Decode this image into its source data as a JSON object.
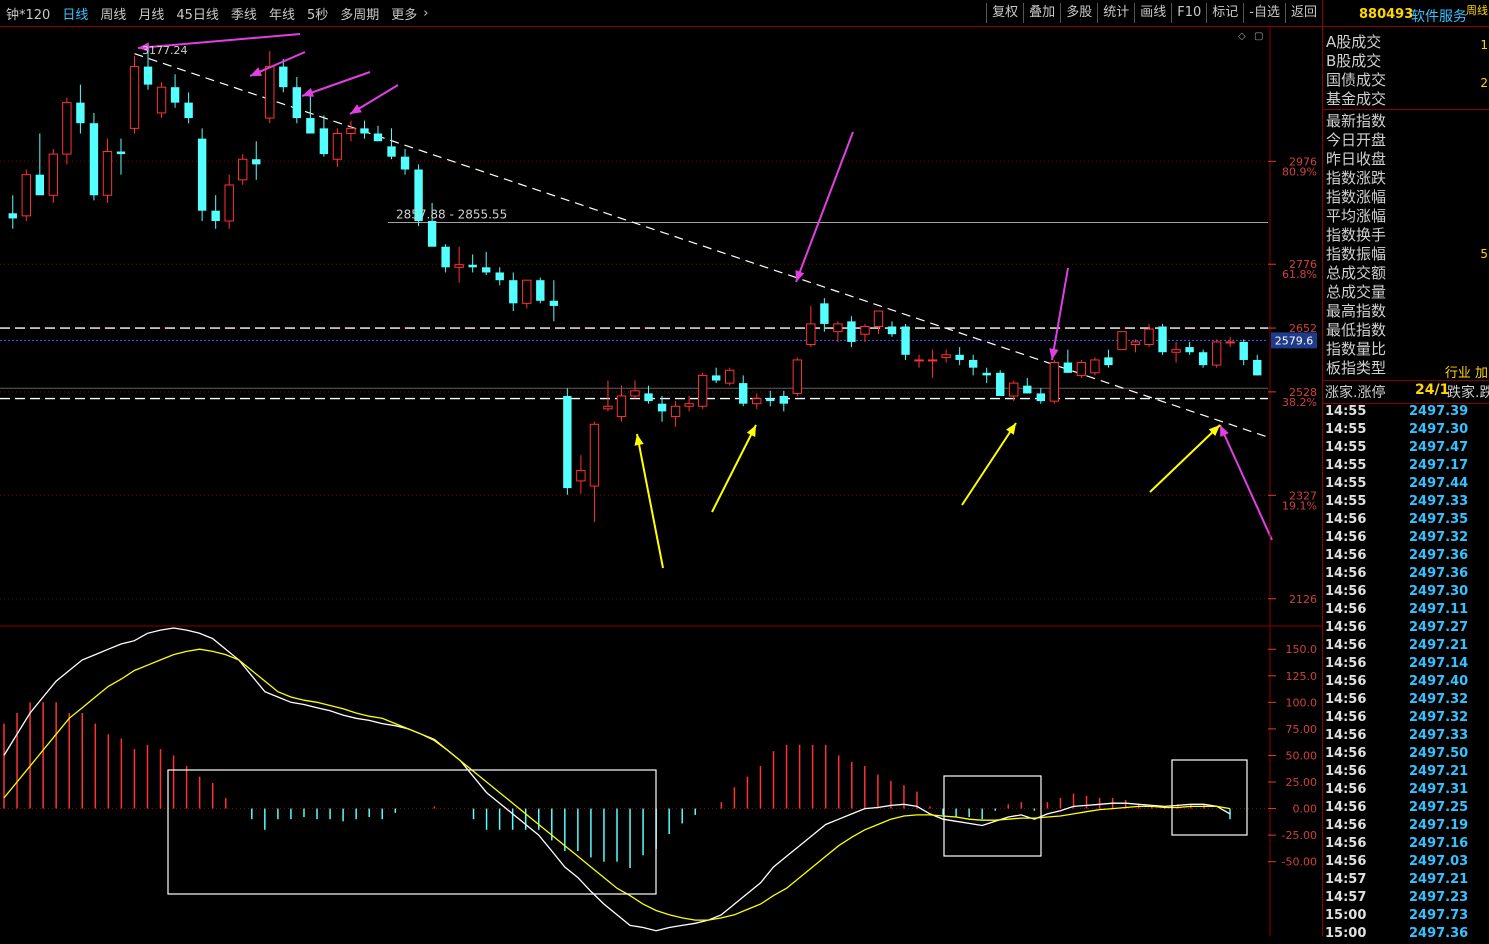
{
  "toolbar": {
    "period_tabs": [
      "钟*120",
      "日线",
      "周线",
      "月线",
      "45日线",
      "季线",
      "年线",
      "5秒",
      "多周期",
      "更多"
    ],
    "active_period": "日线",
    "more_chevron_icon": "chevron-right-icon",
    "buttons": [
      "复权",
      "叠加",
      "多股",
      "统计",
      "画线",
      "F10",
      "标记",
      "-自选",
      "返回"
    ]
  },
  "stock": {
    "code": "880493",
    "name": "软件服务",
    "tag": "周线"
  },
  "chart_data": [
    {
      "type": "candlestick",
      "ylim": [
        2075,
        3235
      ],
      "candles": [
        {
          "o": 2875,
          "h": 2910,
          "l": 2845,
          "c": 2865
        },
        {
          "o": 2870,
          "h": 2960,
          "l": 2860,
          "c": 2950
        },
        {
          "o": 2950,
          "h": 3030,
          "l": 2920,
          "c": 2910
        },
        {
          "o": 2910,
          "h": 3000,
          "l": 2895,
          "c": 2990
        },
        {
          "o": 2990,
          "h": 3100,
          "l": 2970,
          "c": 3090
        },
        {
          "o": 3090,
          "h": 3125,
          "l": 3030,
          "c": 3050
        },
        {
          "o": 3050,
          "h": 3070,
          "l": 2900,
          "c": 2910
        },
        {
          "o": 2910,
          "h": 3020,
          "l": 2895,
          "c": 2995
        },
        {
          "o": 2995,
          "h": 3020,
          "l": 2950,
          "c": 2990
        },
        {
          "o": 3040,
          "h": 3180,
          "l": 3030,
          "c": 3160
        },
        {
          "o": 3160,
          "h": 3200,
          "l": 3115,
          "c": 3125
        },
        {
          "o": 3070,
          "h": 3130,
          "l": 3060,
          "c": 3120
        },
        {
          "o": 3120,
          "h": 3145,
          "l": 3080,
          "c": 3090
        },
        {
          "o": 3090,
          "h": 3110,
          "l": 3050,
          "c": 3060
        },
        {
          "o": 3020,
          "h": 3040,
          "l": 2860,
          "c": 2880
        },
        {
          "o": 2880,
          "h": 2910,
          "l": 2845,
          "c": 2860
        },
        {
          "o": 2860,
          "h": 2950,
          "l": 2845,
          "c": 2930
        },
        {
          "o": 2940,
          "h": 2990,
          "l": 2930,
          "c": 2980
        },
        {
          "o": 2980,
          "h": 3015,
          "l": 2940,
          "c": 2970
        },
        {
          "o": 3060,
          "h": 3190,
          "l": 3050,
          "c": 3160
        },
        {
          "o": 3160,
          "h": 3175,
          "l": 3110,
          "c": 3120
        },
        {
          "o": 3120,
          "h": 3140,
          "l": 3050,
          "c": 3060
        },
        {
          "o": 3060,
          "h": 3110,
          "l": 3030,
          "c": 3030
        },
        {
          "o": 3040,
          "h": 3065,
          "l": 2985,
          "c": 2990
        },
        {
          "o": 2980,
          "h": 3040,
          "l": 2965,
          "c": 3030
        },
        {
          "o": 3030,
          "h": 3055,
          "l": 3015,
          "c": 3040
        },
        {
          "o": 3040,
          "h": 3055,
          "l": 3020,
          "c": 3030
        },
        {
          "o": 3030,
          "h": 3045,
          "l": 3015,
          "c": 3015
        },
        {
          "o": 3005,
          "h": 3040,
          "l": 2980,
          "c": 2985
        },
        {
          "o": 2985,
          "h": 3000,
          "l": 2950,
          "c": 2960
        },
        {
          "o": 2960,
          "h": 2970,
          "l": 2850,
          "c": 2860
        },
        {
          "o": 2860,
          "h": 2895,
          "l": 2835,
          "c": 2810
        },
        {
          "o": 2810,
          "h": 2815,
          "l": 2760,
          "c": 2770
        },
        {
          "o": 2770,
          "h": 2810,
          "l": 2740,
          "c": 2775
        },
        {
          "o": 2775,
          "h": 2795,
          "l": 2760,
          "c": 2770
        },
        {
          "o": 2770,
          "h": 2800,
          "l": 2755,
          "c": 2760
        },
        {
          "o": 2760,
          "h": 2770,
          "l": 2735,
          "c": 2745
        },
        {
          "o": 2745,
          "h": 2760,
          "l": 2685,
          "c": 2700
        },
        {
          "o": 2700,
          "h": 2745,
          "l": 2690,
          "c": 2745
        },
        {
          "o": 2745,
          "h": 2750,
          "l": 2700,
          "c": 2705
        },
        {
          "o": 2705,
          "h": 2745,
          "l": 2665,
          "c": 2695
        },
        {
          "o": 2520,
          "h": 2535,
          "l": 2328,
          "c": 2341
        },
        {
          "o": 2355,
          "h": 2405,
          "l": 2330,
          "c": 2375
        },
        {
          "o": 2345,
          "h": 2470,
          "l": 2275,
          "c": 2465
        },
        {
          "o": 2495,
          "h": 2550,
          "l": 2490,
          "c": 2500
        },
        {
          "o": 2480,
          "h": 2540,
          "l": 2470,
          "c": 2520
        },
        {
          "o": 2520,
          "h": 2550,
          "l": 2515,
          "c": 2530
        },
        {
          "o": 2525,
          "h": 2540,
          "l": 2505,
          "c": 2510
        },
        {
          "o": 2505,
          "h": 2520,
          "l": 2470,
          "c": 2490
        },
        {
          "o": 2480,
          "h": 2510,
          "l": 2460,
          "c": 2500
        },
        {
          "o": 2500,
          "h": 2520,
          "l": 2490,
          "c": 2505
        },
        {
          "o": 2500,
          "h": 2565,
          "l": 2495,
          "c": 2560
        },
        {
          "o": 2560,
          "h": 2575,
          "l": 2545,
          "c": 2550
        },
        {
          "o": 2545,
          "h": 2575,
          "l": 2540,
          "c": 2570
        },
        {
          "o": 2545,
          "h": 2560,
          "l": 2500,
          "c": 2505
        },
        {
          "o": 2505,
          "h": 2525,
          "l": 2495,
          "c": 2515
        },
        {
          "o": 2515,
          "h": 2530,
          "l": 2500,
          "c": 2510
        },
        {
          "o": 2520,
          "h": 2530,
          "l": 2490,
          "c": 2505
        },
        {
          "o": 2525,
          "h": 2595,
          "l": 2520,
          "c": 2590
        },
        {
          "o": 2620,
          "h": 2695,
          "l": 2615,
          "c": 2660
        },
        {
          "o": 2700,
          "h": 2710,
          "l": 2645,
          "c": 2660
        },
        {
          "o": 2645,
          "h": 2665,
          "l": 2625,
          "c": 2660
        },
        {
          "o": 2665,
          "h": 2675,
          "l": 2615,
          "c": 2625
        },
        {
          "o": 2640,
          "h": 2660,
          "l": 2625,
          "c": 2655
        },
        {
          "o": 2655,
          "h": 2685,
          "l": 2640,
          "c": 2685
        },
        {
          "o": 2655,
          "h": 2665,
          "l": 2635,
          "c": 2640
        },
        {
          "o": 2655,
          "h": 2660,
          "l": 2590,
          "c": 2600
        },
        {
          "o": 2590,
          "h": 2600,
          "l": 2575,
          "c": 2590
        },
        {
          "o": 2590,
          "h": 2610,
          "l": 2555,
          "c": 2590
        },
        {
          "o": 2595,
          "h": 2610,
          "l": 2585,
          "c": 2600
        },
        {
          "o": 2600,
          "h": 2615,
          "l": 2580,
          "c": 2590
        },
        {
          "o": 2590,
          "h": 2600,
          "l": 2560,
          "c": 2575
        },
        {
          "o": 2565,
          "h": 2575,
          "l": 2545,
          "c": 2560
        },
        {
          "o": 2565,
          "h": 2570,
          "l": 2525,
          "c": 2520
        },
        {
          "o": 2520,
          "h": 2550,
          "l": 2510,
          "c": 2545
        },
        {
          "o": 2540,
          "h": 2555,
          "l": 2525,
          "c": 2525
        },
        {
          "o": 2525,
          "h": 2535,
          "l": 2505,
          "c": 2510
        },
        {
          "o": 2510,
          "h": 2590,
          "l": 2505,
          "c": 2585
        },
        {
          "o": 2585,
          "h": 2610,
          "l": 2565,
          "c": 2565
        },
        {
          "o": 2560,
          "h": 2590,
          "l": 2555,
          "c": 2585
        },
        {
          "o": 2565,
          "h": 2595,
          "l": 2560,
          "c": 2590
        },
        {
          "o": 2595,
          "h": 2610,
          "l": 2575,
          "c": 2580
        },
        {
          "o": 2610,
          "h": 2625,
          "l": 2615,
          "c": 2645
        },
        {
          "o": 2620,
          "h": 2630,
          "l": 2605,
          "c": 2625
        },
        {
          "o": 2620,
          "h": 2660,
          "l": 2615,
          "c": 2650
        },
        {
          "o": 2655,
          "h": 2660,
          "l": 2600,
          "c": 2605
        },
        {
          "o": 2605,
          "h": 2625,
          "l": 2585,
          "c": 2610
        },
        {
          "o": 2615,
          "h": 2625,
          "l": 2600,
          "c": 2605
        },
        {
          "o": 2605,
          "h": 2610,
          "l": 2575,
          "c": 2580
        },
        {
          "o": 2580,
          "h": 2630,
          "l": 2575,
          "c": 2625
        },
        {
          "o": 2625,
          "h": 2635,
          "l": 2615,
          "c": 2625
        },
        {
          "o": 2625,
          "h": 2630,
          "l": 2580,
          "c": 2590
        },
        {
          "o": 2590,
          "h": 2600,
          "l": 2560,
          "c": 2560
        }
      ],
      "price_labels": [
        {
          "value": 2976,
          "pct": "80.9%"
        },
        {
          "value": 2776,
          "pct": "61.8%"
        },
        {
          "value": 2652,
          "pct": ""
        },
        {
          "value": 2528,
          "pct": "38.2%"
        },
        {
          "value": 2327,
          "pct": "19.1%"
        },
        {
          "value": 2126,
          "pct": ""
        }
      ],
      "current_price": "2579.6",
      "high_label": "3177.24",
      "range_label": "2857.88 - 2855.55"
    },
    {
      "type": "macd",
      "ylim": [
        -120,
        170
      ],
      "yticks": [
        "150.0",
        "125.0",
        "100.0",
        "75.00",
        "50.00",
        "25.00",
        "0.00",
        "-25.00",
        "-50.00"
      ],
      "dif": [
        50,
        70,
        90,
        105,
        120,
        130,
        140,
        145,
        150,
        155,
        158,
        165,
        168,
        170,
        168,
        165,
        160,
        150,
        140,
        125,
        110,
        105,
        100,
        98,
        95,
        92,
        88,
        85,
        83,
        80,
        78,
        75,
        70,
        65,
        55,
        45,
        30,
        15,
        5,
        -5,
        -15,
        -25,
        -40,
        -55,
        -65,
        -78,
        -90,
        -100,
        -110,
        -112,
        -115,
        -112,
        -110,
        -108,
        -105,
        -100,
        -90,
        -80,
        -70,
        -55,
        -45,
        -35,
        -25,
        -15,
        -10,
        -5,
        0,
        1,
        3,
        4,
        2,
        -5,
        -10,
        -12,
        -14,
        -16,
        -12,
        -8,
        -6,
        -10,
        -5,
        -2,
        2,
        3,
        4,
        5,
        5,
        4,
        3,
        2,
        3,
        4,
        4,
        2,
        -5
      ],
      "dea": [
        10,
        25,
        40,
        55,
        70,
        85,
        95,
        105,
        115,
        122,
        130,
        135,
        140,
        145,
        148,
        150,
        148,
        145,
        140,
        130,
        120,
        110,
        105,
        102,
        100,
        97,
        94,
        90,
        87,
        85,
        80,
        75,
        70,
        64,
        55,
        45,
        35,
        25,
        15,
        5,
        -5,
        -15,
        -25,
        -35,
        -45,
        -55,
        -65,
        -75,
        -82,
        -90,
        -96,
        -100,
        -103,
        -105,
        -105,
        -103,
        -100,
        -95,
        -90,
        -82,
        -75,
        -65,
        -55,
        -45,
        -35,
        -27,
        -20,
        -15,
        -10,
        -7,
        -6,
        -6,
        -7,
        -8,
        -10,
        -11,
        -11,
        -10,
        -9,
        -9,
        -8,
        -7,
        -5,
        -3,
        -1,
        0,
        1,
        2,
        2,
        1,
        1,
        2,
        2,
        2,
        0
      ],
      "boxes": 3
    }
  ],
  "panel": {
    "labels_top": [
      "A股成交",
      "B股成交",
      "国债成交",
      "基金成交"
    ],
    "labels_main": [
      "最新指数",
      "今日开盘",
      "昨日收盘",
      "指数涨跌",
      "指数涨幅",
      "平均涨幅",
      "指数换手",
      "指数振幅",
      "总成交额",
      "总成交量",
      "最高指数",
      "最低指数",
      "指数量比",
      "板指类型"
    ],
    "right_values": [
      {
        "row": 0,
        "v": "1"
      },
      {
        "row": 2,
        "v": "2"
      },
      {
        "row": 11,
        "v": "5"
      }
    ],
    "board_type_value": "行业 加",
    "tick_header": {
      "left": "涨家.涨停",
      "mid": "24/1",
      "right": "跌家.跌"
    },
    "ticks": [
      [
        "14:55",
        "2497.39"
      ],
      [
        "14:55",
        "2497.30"
      ],
      [
        "14:55",
        "2497.47"
      ],
      [
        "14:55",
        "2497.17"
      ],
      [
        "14:55",
        "2497.44"
      ],
      [
        "14:55",
        "2497.33"
      ],
      [
        "14:56",
        "2497.35"
      ],
      [
        "14:56",
        "2497.32"
      ],
      [
        "14:56",
        "2497.36"
      ],
      [
        "14:56",
        "2497.36"
      ],
      [
        "14:56",
        "2497.30"
      ],
      [
        "14:56",
        "2497.11"
      ],
      [
        "14:56",
        "2497.27"
      ],
      [
        "14:56",
        "2497.21"
      ],
      [
        "14:56",
        "2497.14"
      ],
      [
        "14:56",
        "2497.40"
      ],
      [
        "14:56",
        "2497.32"
      ],
      [
        "14:56",
        "2497.32"
      ],
      [
        "14:56",
        "2497.33"
      ],
      [
        "14:56",
        "2497.50"
      ],
      [
        "14:56",
        "2497.21"
      ],
      [
        "14:56",
        "2497.31"
      ],
      [
        "14:56",
        "2497.25"
      ],
      [
        "14:56",
        "2497.19"
      ],
      [
        "14:56",
        "2497.16"
      ],
      [
        "14:56",
        "2497.03"
      ],
      [
        "14:57",
        "2497.21"
      ],
      [
        "14:57",
        "2497.23"
      ],
      [
        "15:00",
        "2497.73"
      ],
      [
        "15:00",
        "2497.36"
      ]
    ]
  }
}
